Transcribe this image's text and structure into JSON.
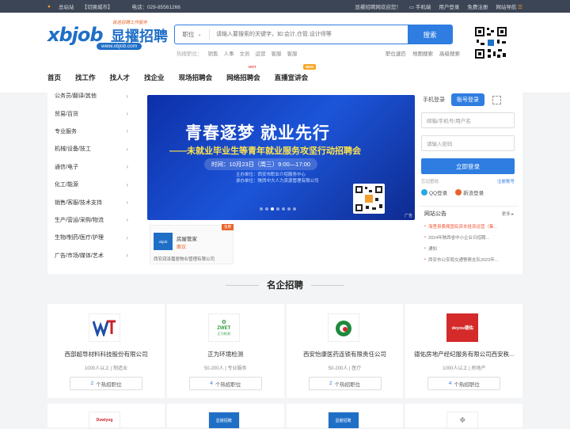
{
  "topbar": {
    "site": "总站站",
    "switch_city": "【切换城市】",
    "phone": "电话：029-85561266",
    "welcome": "显擢招聘网欢迎您！",
    "mobile": "手机端",
    "user_login": "用户登录",
    "free_register": "免费注册",
    "site_nav": "网站导航"
  },
  "logo": {
    "tagline": "首选招聘工作服务",
    "mark": "xbjob",
    "cn": "显擢招聘",
    "url": "www.xbjob.com"
  },
  "search": {
    "category": "职位",
    "placeholder": "请输入要搜索的关键字，如:会计,仓管,设计师等",
    "button": "搜索"
  },
  "hot": {
    "label": "热搜职位：",
    "items": [
      "销售",
      "人事",
      "文员",
      "运营",
      "客服",
      "客服"
    ]
  },
  "header_links": [
    "职位速匹",
    "地图搜索",
    "高级搜索"
  ],
  "nav": {
    "items": [
      "首页",
      "找工作",
      "找人才",
      "找企业",
      "现场招聘会",
      "网络招聘会",
      "直播宣讲会"
    ],
    "badges": {
      "hot": "HOT",
      "new": "NEW"
    }
  },
  "categories": [
    "公务员/翻译/其他",
    "贸易/百货",
    "专业服务",
    "机械/设备/技工",
    "通信/电子",
    "化工/能源",
    "销售/客服/技术支持",
    "生产/营运/采购/物流",
    "生物/制药/医疗/护理",
    "广告/市场/媒体/艺术"
  ],
  "banner": {
    "title": "青春逐梦  就业先行",
    "subtitle": "——未就业毕业生等青年就业服务攻坚行动招聘会",
    "time": "时间：10月23日（周三）9:00—17:00",
    "host": "主办单位：西安市职业介绍服务中心",
    "organizer": "承办单位：陕西中大人力资源管理有限公司",
    "ad": "广告"
  },
  "promo": {
    "badge": "急聘",
    "logo_text": "xbjob",
    "name": "房屋管家",
    "salary": "面议",
    "company": "西安润泽嘉居物业管理有限公司"
  },
  "login": {
    "tab_mobile": "手机登录",
    "tab_account": "账号登录",
    "user_placeholder": "邮箱/手机号/用户名",
    "pass_placeholder": "请输入密码",
    "submit": "立即登录",
    "forgot": "忘记密码",
    "register": "注册账号",
    "qq": "QQ登录",
    "weibo": "新浪登录"
  },
  "notice": {
    "title": "网站公告",
    "more": "更多",
    "items": [
      "海里县委阁国有资本投资运营（集...",
      "2024年陕西省中小企业日招聘...",
      "通知",
      "西安市公安局交通警察支队2023年..."
    ]
  },
  "section": {
    "title": "名企招聘"
  },
  "companies": [
    {
      "name": "西部超导材料科技股份有限公司",
      "size": "1000人以上",
      "industry": "制造业",
      "jobs": "2",
      "jobs_label": "个热招职位"
    },
    {
      "name": "正为环境检测",
      "size": "50-200人",
      "industry": "专业服务",
      "jobs": "4",
      "jobs_label": "个热招职位",
      "logo_text": "ZWET",
      "logo_sub": "正为检测"
    },
    {
      "name": "西安怡康医药连锁有限责任公司",
      "size": "50-200人",
      "industry": "医疗",
      "jobs": "2",
      "jobs_label": "个热招职位"
    },
    {
      "name": "德佑房地产经纪服务有限公司西安秩...",
      "size": "1000人以上",
      "industry": "房地产",
      "jobs": "4",
      "jobs_label": "个热招职位",
      "logo_text": "deyou德佑"
    }
  ],
  "companies_row2": [
    {
      "logo_text": "Dowlyng"
    },
    {
      "logo_text": "显擢招聘"
    },
    {
      "logo_text": "显擢招聘"
    },
    {
      "logo_text": ""
    }
  ]
}
